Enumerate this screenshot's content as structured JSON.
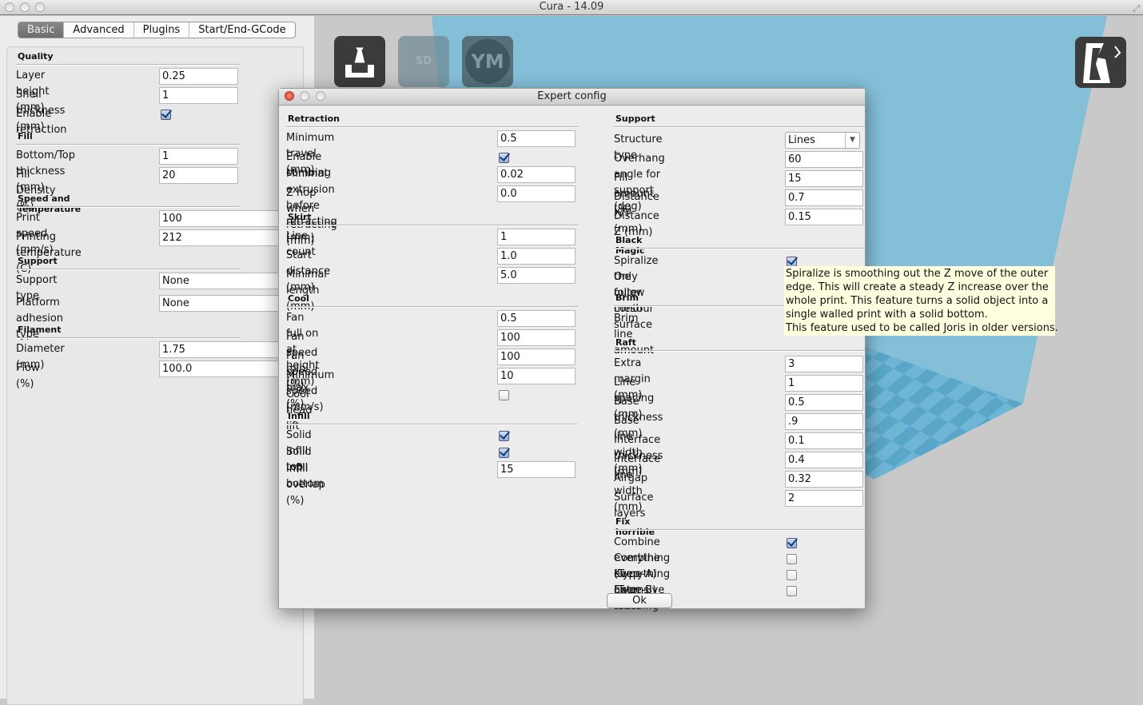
{
  "window": {
    "title": "Cura - 14.09"
  },
  "tabs": [
    {
      "label": "Basic",
      "active": true
    },
    {
      "label": "Advanced"
    },
    {
      "label": "Plugins"
    },
    {
      "label": "Start/End-GCode"
    }
  ],
  "basic": [
    {
      "section": "Quality",
      "rows": [
        {
          "label": "Layer height (mm)",
          "type": "input",
          "value": "0.25"
        },
        {
          "label": "Shell thickness (mm)",
          "type": "input",
          "value": "1"
        },
        {
          "label": "Enable retraction",
          "type": "check",
          "checked": true
        }
      ]
    },
    {
      "section": "Fill",
      "rows": [
        {
          "label": "Bottom/Top thickness (mm)",
          "type": "input",
          "value": "1"
        },
        {
          "label": "Fill Density (%)",
          "type": "input",
          "value": "20"
        }
      ]
    },
    {
      "section": "Speed and Temperature",
      "rows": [
        {
          "label": "Print speed (mm/s)",
          "type": "input",
          "value": "100",
          "wide": true
        },
        {
          "label": "Printing temperature (C)",
          "type": "input",
          "value": "212",
          "wide": true
        }
      ]
    },
    {
      "section": "Support",
      "rows": [
        {
          "label": "Support type",
          "type": "input",
          "value": "None",
          "wide": true,
          "tall": true
        },
        {
          "label": "Platform adhesion type",
          "type": "input",
          "value": "None",
          "wide": true,
          "tall": true
        }
      ]
    },
    {
      "section": "Filament",
      "rows": [
        {
          "label": "Diameter (mm)",
          "type": "input",
          "value": "1.75",
          "wide": true
        },
        {
          "label": "Flow (%)",
          "type": "input",
          "value": "100.0",
          "wide": true
        }
      ]
    }
  ],
  "toolbar": {
    "load_icon": "load-model-icon",
    "sd_icon": "sd-card-icon",
    "sd_label": "SD",
    "ym_icon": "youmagine-icon",
    "ym_label": "YM",
    "view_icon": "view-mode-icon"
  },
  "dialog": {
    "title": "Expert config",
    "ok_label": "Ok",
    "left": [
      {
        "section": "Retraction",
        "rows": [
          {
            "label": "Minimum travel (mm)",
            "type": "input",
            "value": "0.5"
          },
          {
            "label": "Enable combing",
            "type": "check",
            "checked": true
          },
          {
            "label": "Minimal extrusion before retracting (mm)",
            "type": "input",
            "value": "0.02"
          },
          {
            "label": "Z hop when retracting (mm)",
            "type": "input",
            "value": "0.0"
          }
        ]
      },
      {
        "section": "Skirt",
        "rows": [
          {
            "label": "Line count",
            "type": "input",
            "value": "1"
          },
          {
            "label": "Start distance (mm)",
            "type": "input",
            "value": "1.0"
          },
          {
            "label": "Minimal length (mm)",
            "type": "input",
            "value": "5.0"
          }
        ]
      },
      {
        "section": "Cool",
        "rows": [
          {
            "label": "Fan full on at height (mm)",
            "type": "input",
            "value": "0.5"
          },
          {
            "label": "Fan speed min (%)",
            "type": "input",
            "value": "100"
          },
          {
            "label": "Fan speed max (%)",
            "type": "input",
            "value": "100"
          },
          {
            "label": "Minimum speed (mm/s)",
            "type": "input",
            "value": "10"
          },
          {
            "label": "Cool head lift",
            "type": "check",
            "checked": false
          }
        ]
      },
      {
        "section": "Infill",
        "rows": [
          {
            "label": "Solid infill top",
            "type": "check",
            "checked": true
          },
          {
            "label": "Solid infill bottom",
            "type": "check",
            "checked": true
          },
          {
            "label": "Infill overlap (%)",
            "type": "input",
            "value": "15"
          }
        ]
      }
    ],
    "right": [
      {
        "section": "Support",
        "rows": [
          {
            "label": "Structure type",
            "type": "select",
            "value": "Lines"
          },
          {
            "label": "Overhang angle for support (deg)",
            "type": "input",
            "value": "60"
          },
          {
            "label": "Fill amount (%)",
            "type": "input",
            "value": "15"
          },
          {
            "label": "Distance X/Y (mm)",
            "type": "input",
            "value": "0.7"
          },
          {
            "label": "Distance Z (mm)",
            "type": "input",
            "value": "0.15"
          }
        ]
      },
      {
        "section": "Black Magic",
        "rows": [
          {
            "label": "Spiralize the outer contour",
            "type": "check",
            "checked": true
          },
          {
            "label": "Only follow mesh surface",
            "type": "check",
            "checked": false,
            "hidden_by_tooltip": true
          }
        ]
      },
      {
        "section": "Brim",
        "rows": [
          {
            "label": "Brim line amount",
            "type": "input",
            "value": "",
            "hidden_by_tooltip": true
          }
        ]
      },
      {
        "section": "Raft",
        "rows": [
          {
            "label": "Extra margin (mm)",
            "type": "input",
            "value": "3"
          },
          {
            "label": "Line spacing (mm)",
            "type": "input",
            "value": "1"
          },
          {
            "label": "Base thickness (mm)",
            "type": "input",
            "value": "0.5"
          },
          {
            "label": "Base line width (mm)",
            "type": "input",
            "value": ".9"
          },
          {
            "label": "Interface thickness (mm)",
            "type": "input",
            "value": "0.1"
          },
          {
            "label": "Interface line width (mm)",
            "type": "input",
            "value": "0.4"
          },
          {
            "label": "Airgap",
            "type": "input",
            "value": "0.32"
          },
          {
            "label": "Surface layers",
            "type": "input",
            "value": "2"
          }
        ]
      },
      {
        "section": "Fix horrible",
        "rows": [
          {
            "label": "Combine everything (Type-A)",
            "type": "check",
            "checked": true
          },
          {
            "label": "Combine everything (Type-B)",
            "type": "check",
            "checked": false
          },
          {
            "label": "Keep open faces",
            "type": "check",
            "checked": false
          },
          {
            "label": "Extensive stitching",
            "type": "check",
            "checked": false
          }
        ]
      }
    ],
    "tooltip": [
      "Spiralize is smoothing out the Z move of the outer",
      "edge. This will create a steady Z increase over the",
      "whole print. This feature turns a solid object into a",
      "single walled print with a solid bottom.",
      "This feature used to be called Joris in older versions."
    ]
  },
  "colors": {
    "bed": "#84bfd8",
    "bed_grid": "#5aa9cc",
    "tooltip_bg": "#ffffe0"
  }
}
